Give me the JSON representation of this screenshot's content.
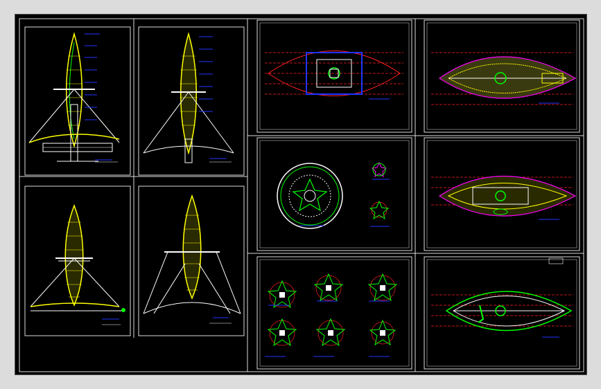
{
  "drawing": {
    "background": "#000000",
    "line_color": "#ffffff",
    "accent_colors": {
      "yellow": "#ffff00",
      "red": "#ff2020",
      "green": "#00ff00",
      "blue": "#2233ff",
      "magenta": "#ff00ff",
      "cyan": "#00ffff"
    }
  },
  "sheets": [
    {
      "id": "elev-1",
      "kind": "tower-elevation"
    },
    {
      "id": "elev-2",
      "kind": "tower-elevation"
    },
    {
      "id": "elev-3",
      "kind": "tower-elevation"
    },
    {
      "id": "elev-4",
      "kind": "tower-elevation"
    },
    {
      "id": "plan-1",
      "kind": "boat-plan"
    },
    {
      "id": "plan-2",
      "kind": "boat-plan"
    },
    {
      "id": "detail-circle",
      "kind": "circular-plan"
    },
    {
      "id": "plan-3",
      "kind": "boat-plan"
    },
    {
      "id": "stars",
      "kind": "star-details"
    },
    {
      "id": "plan-4",
      "kind": "boat-plan"
    }
  ]
}
